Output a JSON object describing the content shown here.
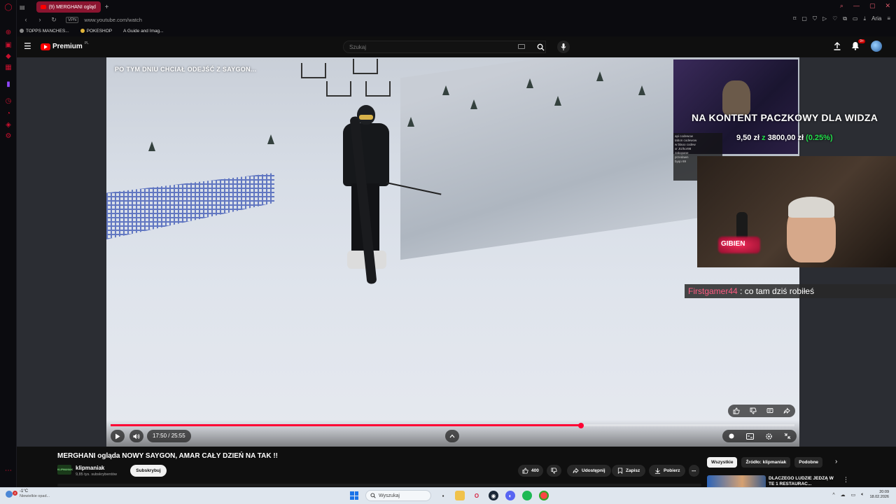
{
  "browser": {
    "tab_title": "(9) MERGHANI ogląd",
    "url": "www.youtube.com/watch",
    "vpn_label": "VPN",
    "bookmarks": [
      "TOPPS MANCHES...",
      "POKESHOP",
      "A Guide and Imag..."
    ],
    "ai_label": "Aria"
  },
  "youtube": {
    "brand": "Premium",
    "region": "PL",
    "search_placeholder": "Szukaj",
    "notif_count": "9+"
  },
  "video": {
    "caption": "PO TYM DNIU CHCIAŁ ODEJŚĆ Z SAYGON...",
    "time": "17:50 / 25:55",
    "progress": 0.688
  },
  "stream": {
    "donation_title": "NA KONTENT PACZKOWY DLA WIDZA",
    "amount": "9,50 zł",
    "z": "z",
    "goal": "3800,00 zł",
    "percent": "(0.25%)",
    "neon": "GIBIEN",
    "chat_user": "Firstgamer44",
    "chat_text": ": co tam dziś robiłeś",
    "mini_chat": [
      "api codewow",
      "tabon codewow",
      "w blaoo codew",
      "xr Jtz/kor98",
      "zakopane",
      "przedawn",
      "byqo 69"
    ]
  },
  "meta": {
    "title": "MERGHANI ogląda NOWY SAYGON, AMAR CAŁY DZIEŃ NA TAK !!",
    "channel": "klipmaniak",
    "subs": "9,85 tys. subskrybentów",
    "subscribe": "Subskrybuj",
    "likes": "400",
    "share": "Udostępnij",
    "save": "Zapisz",
    "download": "Pobierz",
    "channel_logo": "KLIPMANIAK"
  },
  "sidebar_chips": [
    "Wszystkie",
    "Źródło: klipmaniak",
    "Podobne"
  ],
  "recommendation": {
    "title": "DLACZEGO LUDZIE JEDZĄ W TE 1 RESTAURAC..."
  },
  "taskbar": {
    "temp": "-1°C",
    "condition": "Niewielkie opad...",
    "weather_badge": "2",
    "search": "Wyszukaj",
    "time": "20:09",
    "date": "18.02.2026"
  },
  "colors": {
    "accent": "#ff0033",
    "opera_red": "#c8102e",
    "donation_green": "#22e04a",
    "chat_user": "#ff5b82"
  }
}
